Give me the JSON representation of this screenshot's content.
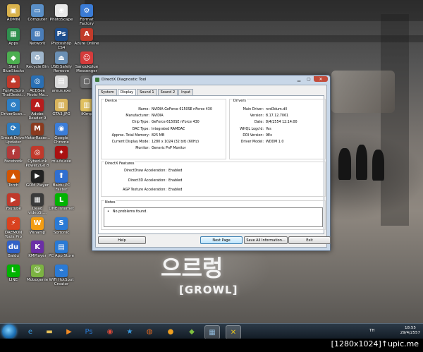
{
  "desktop_icons": [
    {
      "label": "ADMIN",
      "color": "#d9b24c",
      "glyph": "▣"
    },
    {
      "label": "Computer",
      "color": "#5a8fc7",
      "glyph": "▭"
    },
    {
      "label": "PhotoScape",
      "color": "#e9e9e9",
      "glyph": "❀"
    },
    {
      "label": "Format Factory",
      "color": "#3a7bd5",
      "glyph": "⚙"
    },
    {
      "label": "Apps",
      "color": "#2f8f4e",
      "glyph": "▦"
    },
    {
      "label": "Network",
      "color": "#4a7db8",
      "glyph": "⊞"
    },
    {
      "label": "Photoshop CS4",
      "color": "#1e4e8c",
      "glyph": "Ps"
    },
    {
      "label": "Azure Online",
      "color": "#c23b2a",
      "glyph": "A"
    },
    {
      "label": "Start BlueStacks",
      "color": "#4caf50",
      "glyph": "◆"
    },
    {
      "label": "Recycle Bin",
      "color": "#9fb6cc",
      "glyph": "♻"
    },
    {
      "label": "USB Safely Remove",
      "color": "#6a8fb4",
      "glyph": "⏏"
    },
    {
      "label": "Sanookblue Messenger",
      "color": "#d53b3b",
      "glyph": "☺"
    },
    {
      "label": "FunPicSpro ThaiDeskt...",
      "color": "#c0392b",
      "glyph": "♣"
    },
    {
      "label": "ACDSee Photo Ma...",
      "color": "#2a6fb3",
      "glyph": "◎"
    },
    {
      "label": "areus.exe",
      "color": "#d9d9d9",
      "glyph": "▤"
    },
    {
      "label": "",
      "color": "#6b6b6b",
      "glyph": "▢"
    },
    {
      "label": "DriverScan...",
      "color": "#2d7ec4",
      "glyph": "⚙"
    },
    {
      "label": "Adobe Reader 9",
      "color": "#b71c1c",
      "glyph": "A"
    },
    {
      "label": "GTA3.JPG",
      "color": "#d8b35c",
      "glyph": "▥"
    },
    {
      "label": "iKimp",
      "color": "#e0c060",
      "glyph": "▥"
    },
    {
      "label": "Smart Driver Updater",
      "color": "#2c7bbf",
      "glyph": "⟳"
    },
    {
      "label": "MotorRacer...",
      "color": "#8b3a1e",
      "glyph": "M"
    },
    {
      "label": "Google Chrome",
      "color": "#3b7dd8",
      "glyph": "◉"
    },
    {
      "label": "Facebook",
      "color": "#b23a3a",
      "glyph": "f"
    },
    {
      "label": "CyberLink Power2Go 8",
      "color": "#c0392b",
      "glyph": "◎"
    },
    {
      "label": "mu-fe.exe",
      "color": "#a11",
      "glyph": "✦"
    },
    {
      "label": "Torch",
      "color": "#d35400",
      "glyph": "▲"
    },
    {
      "label": "GOM Player",
      "color": "#222",
      "glyph": "▶"
    },
    {
      "label": "Baidu PC Faster",
      "color": "#2f6fd1",
      "glyph": "⬆"
    },
    {
      "label": "Youtube",
      "color": "#c0392b",
      "glyph": "▶"
    },
    {
      "label": "Dead videoSt...",
      "color": "#3a3a3a",
      "glyph": "▦"
    },
    {
      "label": "LINE Internet",
      "color": "#00b300",
      "glyph": "L"
    },
    {
      "label": "DAEMON Tools Pro",
      "color": "#d9421f",
      "glyph": "⚡"
    },
    {
      "label": "Winamp",
      "color": "#f39c12",
      "glyph": "W"
    },
    {
      "label": "Softonic",
      "color": "#2a7ad5",
      "glyph": "S"
    },
    {
      "label": "Baidu",
      "color": "#3161c7",
      "glyph": "du"
    },
    {
      "label": "KMPlayer",
      "color": "#6b2fa6",
      "glyph": "K"
    },
    {
      "label": "PC App Store",
      "color": "#2a7ad5",
      "glyph": "▤"
    },
    {
      "label": "LINE",
      "color": "#00b300",
      "glyph": "L"
    },
    {
      "label": "Mobogenie",
      "color": "#7cb342",
      "glyph": "☺"
    },
    {
      "label": "WiFi HotSpot Creator",
      "color": "#2a7ad5",
      "glyph": "⌁"
    }
  ],
  "dialog": {
    "title": "DirectX Diagnostic Tool",
    "tabs": [
      "System",
      "Display",
      "Sound 1",
      "Sound 2",
      "Input"
    ],
    "active_tab": "Display",
    "device": {
      "group": "Device",
      "fields": [
        {
          "k": "Name:",
          "v": "NVIDIA GeForce 6150SE nForce 430"
        },
        {
          "k": "Manufacturer:",
          "v": "NVIDIA"
        },
        {
          "k": "Chip Type:",
          "v": "GeForce 6150SE nForce 430"
        },
        {
          "k": "DAC Type:",
          "v": "Integrated RAMDAC"
        },
        {
          "k": "Approx. Total Memory:",
          "v": "825 MB"
        },
        {
          "k": "Current Display Mode:",
          "v": "1280 x 1024 (32 bit) (60Hz)"
        },
        {
          "k": "Monitor:",
          "v": "Generic PnP Monitor"
        }
      ]
    },
    "drivers": {
      "group": "Drivers",
      "fields": [
        {
          "k": "Main Driver:",
          "v": "nvd3dum.dll"
        },
        {
          "k": "Version:",
          "v": "8.17.12.7061"
        },
        {
          "k": "Date:",
          "v": "8/4/2554 12:14:00"
        },
        {
          "k": "WHQL Logo'd:",
          "v": "Yes"
        },
        {
          "k": "DDI Version:",
          "v": "9Ex"
        },
        {
          "k": "Driver Model:",
          "v": "WDDM 1.0"
        }
      ]
    },
    "features": {
      "group": "DirectX Features",
      "fields": [
        {
          "k": "DirectDraw Acceleration:",
          "v": "Enabled"
        },
        {
          "k": "Direct3D Acceleration:",
          "v": "Enabled"
        },
        {
          "k": "AGP Texture Acceleration:",
          "v": "Enabled"
        }
      ]
    },
    "notes": {
      "group": "Notes",
      "items": [
        "No problems found."
      ]
    },
    "buttons": {
      "help": "Help",
      "next": "Next Page",
      "save": "Save All Information...",
      "exit": "Exit"
    }
  },
  "wallpaper": {
    "logo": "으르렁",
    "sub": "[GROWL]"
  },
  "taskbar": {
    "apps": [
      {
        "name": "ie-icon",
        "glyph": "e",
        "color": "#3a9be0"
      },
      {
        "name": "explorer-icon",
        "glyph": "▬",
        "color": "#e6c15a"
      },
      {
        "name": "media-player-icon",
        "glyph": "▶",
        "color": "#f08a24"
      },
      {
        "name": "photoshop-icon",
        "glyph": "Ps",
        "color": "#2a7ad5"
      },
      {
        "name": "chrome-icon",
        "glyph": "◉",
        "color": "#e04b3a"
      },
      {
        "name": "favorites-icon",
        "glyph": "★",
        "color": "#3a9be0"
      },
      {
        "name": "firefox-icon",
        "glyph": "◍",
        "color": "#e86a1f"
      },
      {
        "name": "burn-icon",
        "glyph": "●",
        "color": "#f0a020"
      },
      {
        "name": "bluestacks-icon",
        "glyph": "◆",
        "color": "#7fbf3f"
      },
      {
        "name": "photo-viewer-icon",
        "glyph": "▦",
        "color": "#8fb8d8"
      },
      {
        "name": "dxdiag-icon",
        "glyph": "✕",
        "color": "#e2c31e"
      }
    ],
    "lang": "TH",
    "time": "18:55",
    "date": "29/4/2557"
  },
  "footer_text": "[1280x1024]↑upic.me"
}
